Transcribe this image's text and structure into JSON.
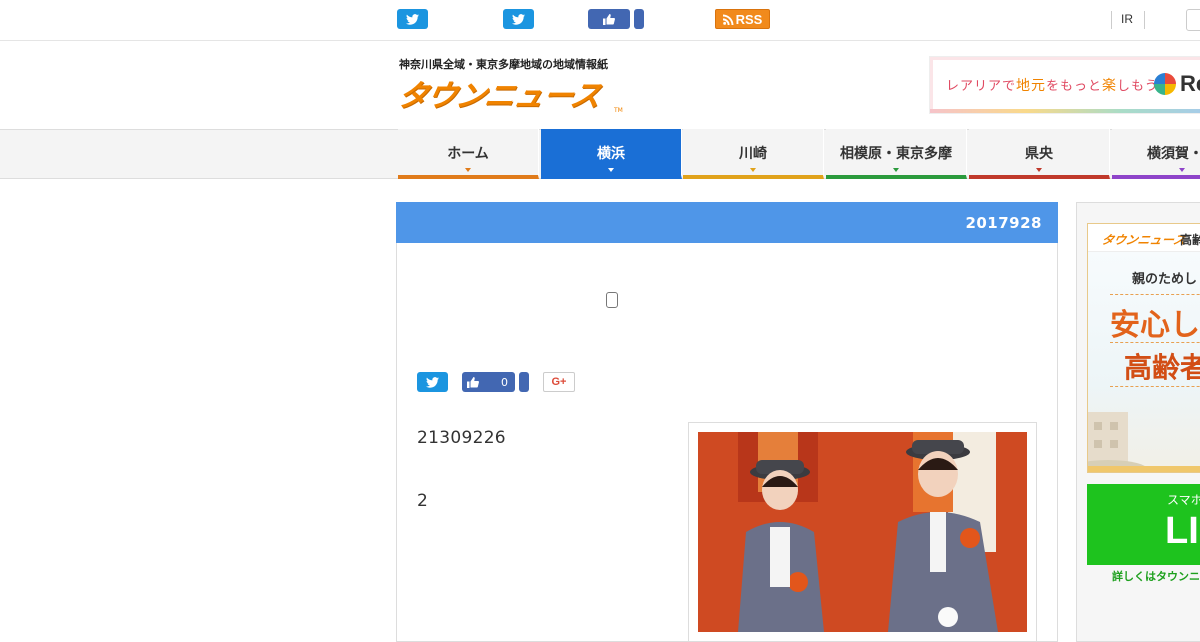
{
  "topbar": {
    "rss_label": "RSS",
    "ir_label": "IR"
  },
  "header": {
    "tagline": "神奈川県全域・東京多摩地域の地域情報紙",
    "logo_text": "タウンニュース",
    "logo_tm": "TM",
    "brand_color": "#f08300"
  },
  "banner": {
    "text_prefix": "レアリア",
    "text_mid1": "で",
    "text_hl": "地元",
    "text_mid2": "をもっと",
    "text_hl2": "楽",
    "text_suffix": "しもう♪",
    "logo_text": "Re"
  },
  "nav": {
    "items": [
      {
        "label": "ホーム",
        "color": "#e07b1a"
      },
      {
        "label": "横浜",
        "color": "#1a6fd6",
        "active": true
      },
      {
        "label": "川崎",
        "color": "#e0a21a"
      },
      {
        "label": "相模原・東京多摩",
        "color": "#2a9a3c"
      },
      {
        "label": "県央",
        "color": "#c0392b"
      },
      {
        "label": "横須賀・三",
        "color": "#8e44c9"
      }
    ]
  },
  "article": {
    "date_header": "2017928",
    "header_color": "#4f96e8",
    "like_count": "0",
    "gplus_label": "G+",
    "body_line1": "21309226",
    "body_line2": "2"
  },
  "sidebar": {
    "ad1": {
      "logo_text": "タウンニュース",
      "head_text": "高齢",
      "line1": "親のためし",
      "line2": "安心し",
      "line3": "高齢者"
    },
    "ad2": {
      "line1": "スマホ",
      "line2": "LI",
      "note": "詳しくはタウンニ"
    }
  }
}
